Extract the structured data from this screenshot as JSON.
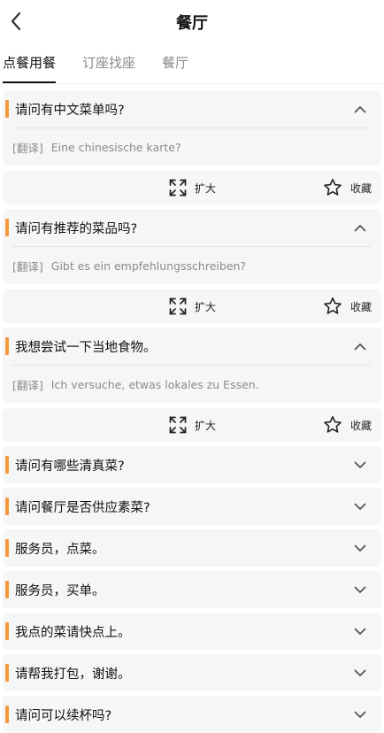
{
  "header": {
    "title": "餐厅",
    "back_icon": "chevron-left-icon"
  },
  "tabs": [
    {
      "label": "点餐用餐",
      "active": true
    },
    {
      "label": "订座找座",
      "active": false
    },
    {
      "label": "餐厅",
      "active": false
    }
  ],
  "accent_color": "#f59a3c",
  "actions": {
    "expand_label": "扩大",
    "favorite_label": "收藏"
  },
  "translation_tag": "[翻译]",
  "expanded": [
    {
      "phrase": "请问有中文菜单吗?",
      "translation": "Eine chinesische karte?"
    },
    {
      "phrase": "请问有推荐的菜品吗?",
      "translation": "Gibt es ein empfehlungsschreiben?"
    },
    {
      "phrase": "我想尝试一下当地食物。",
      "translation": "Ich versuche, etwas lokales zu Essen."
    }
  ],
  "collapsed": [
    {
      "phrase": "请问有哪些清真菜?"
    },
    {
      "phrase": "请问餐厅是否供应素菜?"
    },
    {
      "phrase": "服务员，点菜。"
    },
    {
      "phrase": "服务员，买单。"
    },
    {
      "phrase": "我点的菜请快点上。"
    },
    {
      "phrase": "请帮我打包，谢谢。"
    },
    {
      "phrase": "请问可以续杯吗?"
    }
  ]
}
